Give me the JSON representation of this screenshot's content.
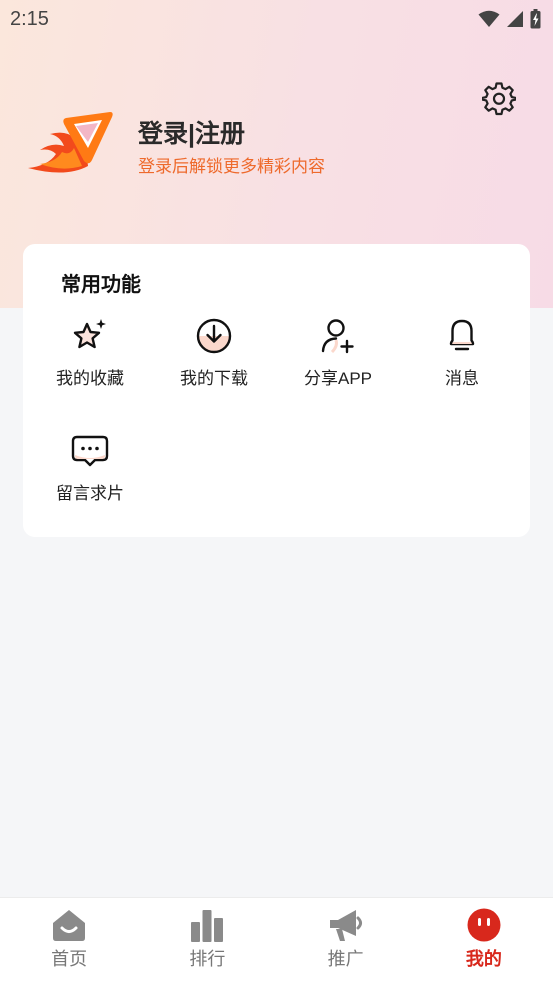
{
  "status_bar": {
    "time": "2:15"
  },
  "profile": {
    "login_title": "登录|注册",
    "login_subtitle": "登录后解锁更多精彩内容"
  },
  "functions_card": {
    "title": "常用功能",
    "items": [
      {
        "label": "我的收藏",
        "icon": "star-sparkle-icon"
      },
      {
        "label": "我的下载",
        "icon": "download-icon"
      },
      {
        "label": "分享APP",
        "icon": "add-user-icon"
      },
      {
        "label": "消息",
        "icon": "bell-icon"
      },
      {
        "label": "留言求片",
        "icon": "chat-bubble-icon"
      }
    ]
  },
  "bottom_nav": {
    "items": [
      {
        "label": "首页",
        "icon": "home-icon",
        "active": false
      },
      {
        "label": "排行",
        "icon": "bar-chart-icon",
        "active": false
      },
      {
        "label": "推广",
        "icon": "megaphone-icon",
        "active": false
      },
      {
        "label": "我的",
        "icon": "profile-face-icon",
        "active": true
      }
    ]
  },
  "colors": {
    "accent": "#ee6a2c",
    "nav_active": "#d8281c",
    "nav_inactive": "#777777",
    "header_gradient_start": "#fbe7dc",
    "header_gradient_end": "#f7dbe6"
  }
}
